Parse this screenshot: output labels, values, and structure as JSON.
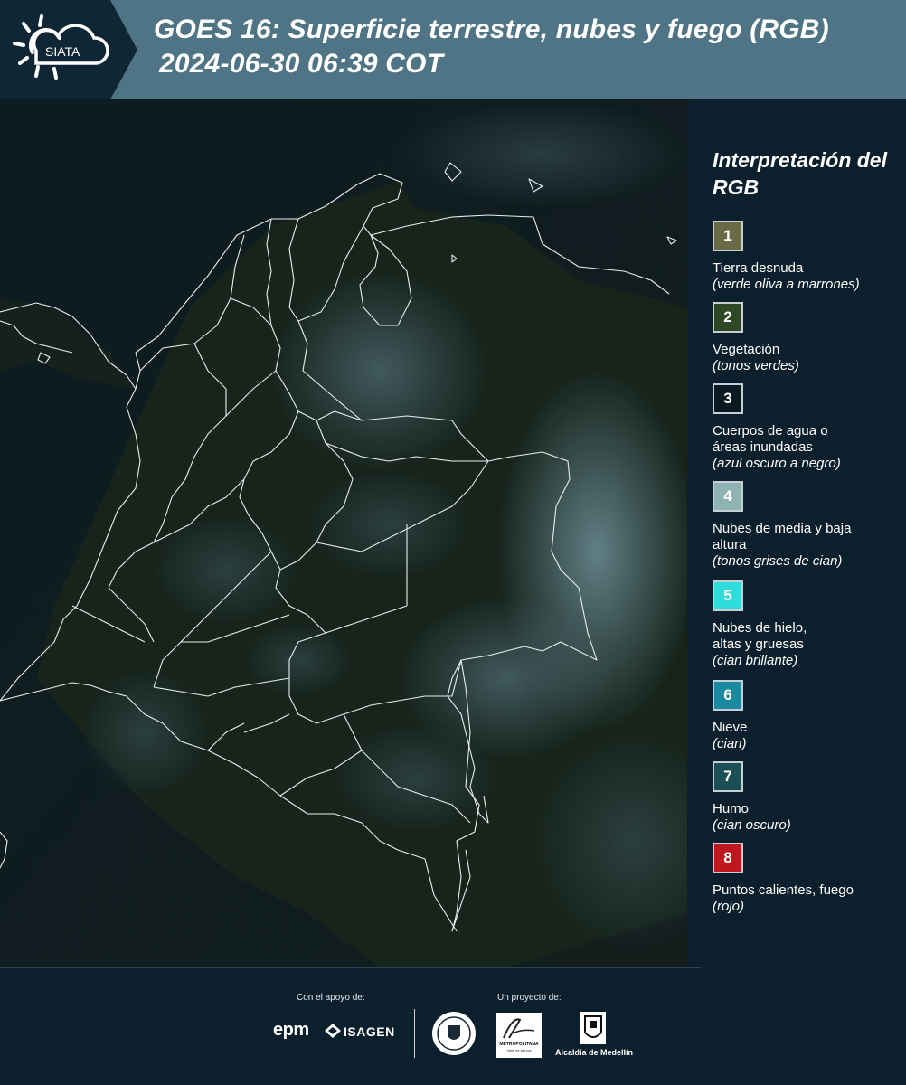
{
  "header": {
    "title_line1": "GOES 16: Superficie terrestre, nubes y fuego (RGB)",
    "title_line2": "2024-06-30 06:39 COT",
    "logo_text": "SIATA",
    "logo_icon": "sun-cloud-icon"
  },
  "legend": {
    "title": "Interpretación del RGB",
    "items": [
      {
        "number": "1",
        "label": "Tierra desnuda",
        "desc": "(verde oliva a marrones)",
        "color": "#6b6a46",
        "text_color": "#ffffff"
      },
      {
        "number": "2",
        "label": "Vegetación",
        "desc": "(tonos verdes)",
        "color": "#2e4724",
        "text_color": "#ffffff"
      },
      {
        "number": "3",
        "label": "Cuerpos de agua o áreas inundadas",
        "desc": "(azul oscuro a negro)",
        "color": "#0b1a22",
        "text_color": "#ffffff"
      },
      {
        "number": "4",
        "label": "Nubes de media y baja altura",
        "desc": "(tonos grises de cian)",
        "color": "#8fb3b4",
        "text_color": "#ffffff"
      },
      {
        "number": "5",
        "label": "Nubes de hielo, altas y gruesas",
        "desc": "(cian brillante)",
        "color": "#2fdcdc",
        "text_color": "#ffffff"
      },
      {
        "number": "6",
        "label": "Nieve",
        "desc": "(cian)",
        "color": "#1b8aa0",
        "text_color": "#ffffff"
      },
      {
        "number": "7",
        "label": "Humo",
        "desc": "(cian oscuro)",
        "color": "#1c4f55",
        "text_color": "#ffffff"
      },
      {
        "number": "8",
        "label": "Puntos calientes, fuego",
        "desc": "(rojo)",
        "color": "#c0161e",
        "text_color": "#ffffff"
      }
    ]
  },
  "footer": {
    "support_label": "Con el apoyo de:",
    "project_label": "Un proyecto de:",
    "epm": "epm",
    "isagen": "ISAGEN",
    "metro_name": "METROPOLITANA",
    "metro_sub": "Valle de Aburrá",
    "alcaldia": "Alcaldía de Medellín"
  },
  "colors": {
    "header_bg": "#0f2735",
    "header_band": "#4e7485",
    "panel_bg": "#0b1f2c",
    "border_line": "#e8eef0"
  }
}
